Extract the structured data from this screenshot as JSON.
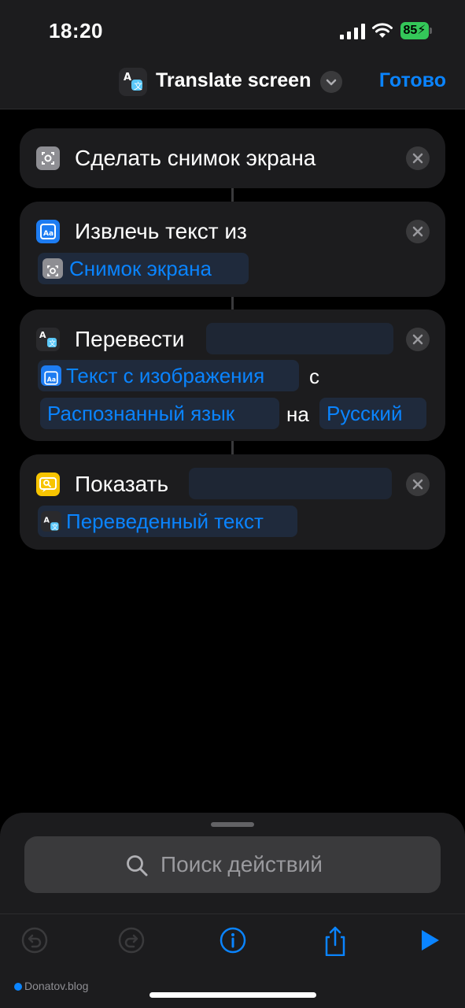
{
  "status_bar": {
    "time": "18:20",
    "battery": "85"
  },
  "nav": {
    "title": "Translate screen",
    "done_label": "Готово"
  },
  "actions": {
    "screenshot": {
      "title": "Сделать снимок экрана"
    },
    "extract": {
      "title": "Извлечь текст из",
      "input_token": "Снимок экрана"
    },
    "translate": {
      "title": "Перевести",
      "text_token": "Текст с изображения",
      "from_word": "с",
      "source_lang": "Распознанный язык",
      "to_word": "на",
      "target_lang": "Русский"
    },
    "show": {
      "title": "Показать",
      "result_token": "Переведенный текст"
    }
  },
  "search": {
    "placeholder": "Поиск действий"
  },
  "watermark": "Donatov.blog",
  "colors": {
    "accent": "#0a84ff",
    "card": "#1c1c1e",
    "battery": "#34c759",
    "show_icon": "#f7c400"
  }
}
